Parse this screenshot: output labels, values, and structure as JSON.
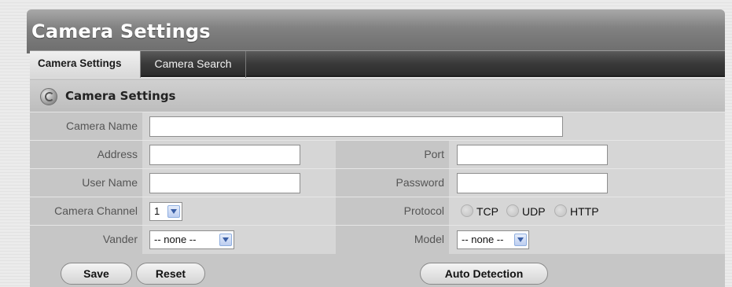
{
  "page": {
    "title": "Camera Settings"
  },
  "tabs": [
    {
      "label": "Camera Settings",
      "active": true
    },
    {
      "label": "Camera Search",
      "active": false
    }
  ],
  "section": {
    "title": "Camera Settings",
    "icon": "gear-icon"
  },
  "form": {
    "camera_name": {
      "label": "Camera Name",
      "value": ""
    },
    "address": {
      "label": "Address",
      "value": ""
    },
    "port": {
      "label": "Port",
      "value": ""
    },
    "user_name": {
      "label": "User Name",
      "value": ""
    },
    "password": {
      "label": "Password",
      "value": ""
    },
    "camera_channel": {
      "label": "Camera Channel",
      "selected": "1"
    },
    "protocol": {
      "label": "Protocol",
      "options": [
        "TCP",
        "UDP",
        "HTTP"
      ],
      "selected": null
    },
    "vander": {
      "label": "Vander",
      "selected": "-- none --"
    },
    "model": {
      "label": "Model",
      "selected": "-- none --"
    }
  },
  "buttons": {
    "save": "Save",
    "reset": "Reset",
    "auto_detection": "Auto Detection"
  },
  "colors": {
    "header": "#7c7c7c",
    "tabbar": "#3a3a3a",
    "panel": "#c6c6c6",
    "accent": "#3b5fa6"
  }
}
